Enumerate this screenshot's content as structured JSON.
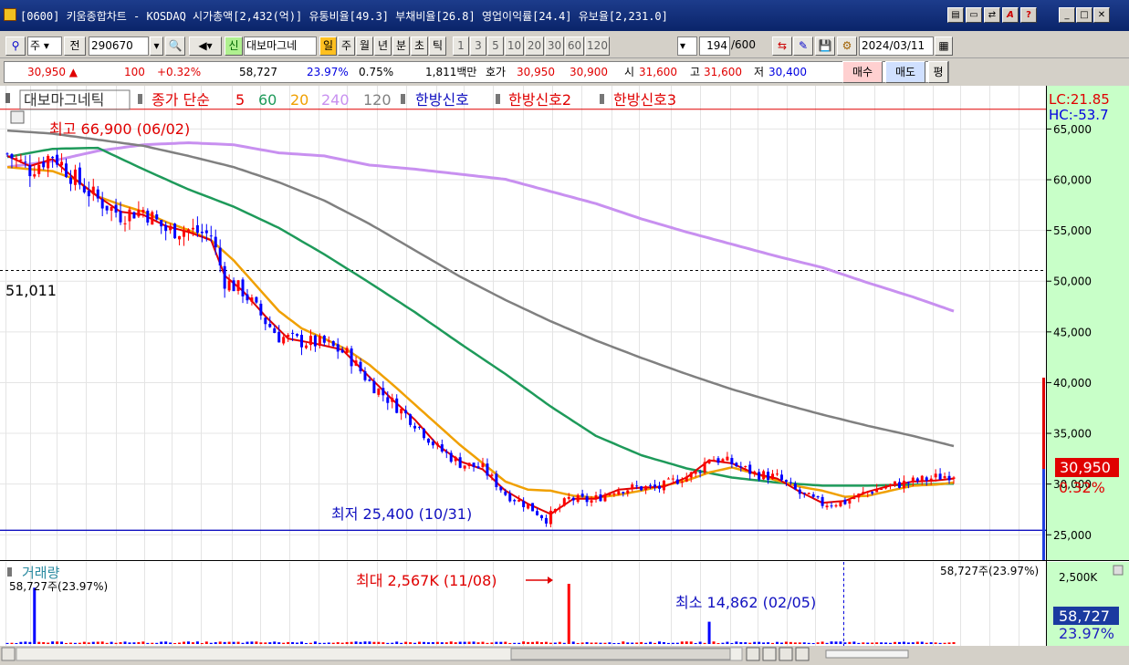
{
  "window": {
    "title": "[0600] 키움종합차트 - KOSDAQ 시가총액[2,432(억)] 유통비율[49.3] 부채비율[26.8] 영업이익률[24.4] 유보율[2,231.0]"
  },
  "toolbar": {
    "period_select": "주",
    "prev_label": "전",
    "code_value": "290670",
    "stock_name": "대보마그네",
    "period_tabs": [
      "일",
      "주",
      "월",
      "년",
      "분",
      "초",
      "틱"
    ],
    "active_period": "일",
    "interval_buttons": [
      "1",
      "3",
      "5",
      "10",
      "20",
      "30",
      "60",
      "120"
    ],
    "count_value": "194",
    "count_total": "/600",
    "date_value": "2024/03/11"
  },
  "quote": {
    "price": "30,950 ▲",
    "change": "100",
    "change_pct": "+0.32%",
    "volume": "58,727",
    "volume_ratio": "23.97%",
    "turnover": "0.75%",
    "amount": "1,811백만",
    "hoga_label": "호가",
    "ask": "30,950",
    "bid": "30,900",
    "open_label": "시",
    "open": "31,600",
    "high_label": "고",
    "high": "31,600",
    "low_label": "저",
    "low": "30,400",
    "buy_label": "매수",
    "sell_label": "매도",
    "avg_label": "평"
  },
  "colors": {
    "up": "#ff0000",
    "down": "#0000ff",
    "ma5": "#e00000",
    "ma60": "#1e9a5a",
    "ma20": "#f0a000",
    "ma240": "#c890f0",
    "ma120": "#808080",
    "axis_bg": "#c8ffc8"
  },
  "chart_data": {
    "type": "line",
    "price_panel": {
      "legend": {
        "name": "대보마그네틱",
        "close_label": "종가 단순",
        "mas": [
          "5",
          "60",
          "20",
          "240",
          "120"
        ],
        "signals": [
          "한방신호",
          "한방신호2",
          "한방신호3"
        ]
      },
      "y_ticks": [
        "65,000",
        "60,000",
        "55,000",
        "50,000",
        "45,000",
        "40,000",
        "35,000",
        "30,000",
        "25,000"
      ],
      "ylim": [
        23000,
        68500
      ],
      "max_label": "최고 66,900 (06/02)",
      "max_value": 66900,
      "min_label": "최저 25,400 (10/31)",
      "min_value": 25400,
      "ref_label": "51,011",
      "ref_value": 51011,
      "current_price_label": "30,950",
      "current_change_label": "0.32%",
      "current_price": 30950,
      "lc_label": "LC:21.85",
      "hc_label": "HC:-53.7",
      "bar_count": 194,
      "close_anchors": [
        [
          0,
          62500
        ],
        [
          5,
          61000
        ],
        [
          10,
          62500
        ],
        [
          15,
          60000
        ],
        [
          20,
          58000
        ],
        [
          25,
          56500
        ],
        [
          30,
          57000
        ],
        [
          35,
          55000
        ],
        [
          40,
          55000
        ],
        [
          45,
          54500
        ],
        [
          48,
          50000
        ],
        [
          52,
          49000
        ],
        [
          57,
          46000
        ],
        [
          60,
          44500
        ],
        [
          65,
          44000
        ],
        [
          70,
          43800
        ],
        [
          75,
          42800
        ],
        [
          80,
          40000
        ],
        [
          85,
          38000
        ],
        [
          90,
          36000
        ],
        [
          95,
          33500
        ],
        [
          100,
          32000
        ],
        [
          105,
          31500
        ],
        [
          110,
          29000
        ],
        [
          115,
          27800
        ],
        [
          119,
          26500
        ],
        [
          124,
          28500
        ],
        [
          129,
          28300
        ],
        [
          134,
          29400
        ],
        [
          139,
          29600
        ],
        [
          144,
          29600
        ],
        [
          149,
          30600
        ],
        [
          152,
          31000
        ],
        [
          155,
          32600
        ],
        [
          160,
          32000
        ],
        [
          165,
          31000
        ],
        [
          170,
          30600
        ],
        [
          175,
          29000
        ],
        [
          180,
          28000
        ],
        [
          185,
          28200
        ],
        [
          190,
          29200
        ],
        [
          195,
          29800
        ],
        [
          200,
          30200
        ],
        [
          205,
          30600
        ],
        [
          209,
          30950
        ]
      ],
      "ma5": [
        [
          0,
          62300
        ],
        [
          5,
          61300
        ],
        [
          10,
          62000
        ],
        [
          15,
          60000
        ],
        [
          20,
          58300
        ],
        [
          25,
          56800
        ],
        [
          30,
          56500
        ],
        [
          35,
          55400
        ],
        [
          40,
          54800
        ],
        [
          45,
          54000
        ],
        [
          48,
          50500
        ],
        [
          52,
          49000
        ],
        [
          57,
          46500
        ],
        [
          62,
          44300
        ],
        [
          68,
          43800
        ],
        [
          74,
          43200
        ],
        [
          80,
          40500
        ],
        [
          85,
          38300
        ],
        [
          90,
          36300
        ],
        [
          95,
          33800
        ],
        [
          100,
          32200
        ],
        [
          105,
          31400
        ],
        [
          110,
          29300
        ],
        [
          115,
          28000
        ],
        [
          120,
          27000
        ],
        [
          125,
          28500
        ],
        [
          130,
          28500
        ],
        [
          135,
          29400
        ],
        [
          140,
          29600
        ],
        [
          145,
          29700
        ],
        [
          150,
          30600
        ],
        [
          155,
          32300
        ],
        [
          160,
          32000
        ],
        [
          165,
          31000
        ],
        [
          170,
          30500
        ],
        [
          175,
          29200
        ],
        [
          180,
          28100
        ],
        [
          185,
          28300
        ],
        [
          190,
          29200
        ],
        [
          195,
          29800
        ],
        [
          200,
          30200
        ],
        [
          205,
          30300
        ],
        [
          209,
          30500
        ]
      ],
      "ma20": [
        [
          0,
          61200
        ],
        [
          5,
          61000
        ],
        [
          10,
          60800
        ],
        [
          15,
          60000
        ],
        [
          20,
          58300
        ],
        [
          25,
          57500
        ],
        [
          30,
          56800
        ],
        [
          35,
          55800
        ],
        [
          40,
          55000
        ],
        [
          45,
          54000
        ],
        [
          50,
          52000
        ],
        [
          55,
          49500
        ],
        [
          60,
          47000
        ],
        [
          65,
          45300
        ],
        [
          70,
          44300
        ],
        [
          75,
          43200
        ],
        [
          80,
          41700
        ],
        [
          85,
          39800
        ],
        [
          90,
          37800
        ],
        [
          95,
          35800
        ],
        [
          100,
          33800
        ],
        [
          105,
          32000
        ],
        [
          110,
          30200
        ],
        [
          115,
          29400
        ],
        [
          120,
          29300
        ],
        [
          125,
          28800
        ],
        [
          130,
          28600
        ],
        [
          135,
          28900
        ],
        [
          140,
          29300
        ],
        [
          145,
          29800
        ],
        [
          150,
          30300
        ],
        [
          155,
          31100
        ],
        [
          160,
          31600
        ],
        [
          165,
          31000
        ],
        [
          170,
          30300
        ],
        [
          175,
          29700
        ],
        [
          180,
          29300
        ],
        [
          185,
          28700
        ],
        [
          190,
          28800
        ],
        [
          195,
          29300
        ],
        [
          200,
          29800
        ],
        [
          205,
          29900
        ],
        [
          209,
          30100
        ]
      ],
      "ma60": [
        [
          0,
          62200
        ],
        [
          10,
          63000
        ],
        [
          20,
          63100
        ],
        [
          30,
          61000
        ],
        [
          40,
          59000
        ],
        [
          50,
          57300
        ],
        [
          60,
          55200
        ],
        [
          70,
          52600
        ],
        [
          80,
          49800
        ],
        [
          90,
          46900
        ],
        [
          100,
          43800
        ],
        [
          110,
          40800
        ],
        [
          120,
          37600
        ],
        [
          130,
          34700
        ],
        [
          140,
          32800
        ],
        [
          150,
          31500
        ],
        [
          160,
          30600
        ],
        [
          170,
          30100
        ],
        [
          180,
          29800
        ],
        [
          190,
          29800
        ],
        [
          200,
          29900
        ],
        [
          209,
          30000
        ]
      ],
      "ma120": [
        [
          0,
          64800
        ],
        [
          10,
          64500
        ],
        [
          20,
          63900
        ],
        [
          30,
          63300
        ],
        [
          40,
          62300
        ],
        [
          50,
          61200
        ],
        [
          60,
          59700
        ],
        [
          70,
          57900
        ],
        [
          80,
          55600
        ],
        [
          90,
          53000
        ],
        [
          100,
          50400
        ],
        [
          110,
          48100
        ],
        [
          120,
          46000
        ],
        [
          130,
          44100
        ],
        [
          140,
          42400
        ],
        [
          150,
          40800
        ],
        [
          160,
          39300
        ],
        [
          170,
          38000
        ],
        [
          180,
          36800
        ],
        [
          190,
          35700
        ],
        [
          200,
          34700
        ],
        [
          209,
          33700
        ]
      ],
      "ma240": [
        [
          0,
          61200
        ],
        [
          10,
          61800
        ],
        [
          20,
          62800
        ],
        [
          30,
          63400
        ],
        [
          40,
          63600
        ],
        [
          50,
          63400
        ],
        [
          60,
          62600
        ],
        [
          70,
          62300
        ],
        [
          80,
          61400
        ],
        [
          90,
          61000
        ],
        [
          100,
          60500
        ],
        [
          110,
          60000
        ],
        [
          120,
          58800
        ],
        [
          130,
          57600
        ],
        [
          140,
          56100
        ],
        [
          150,
          54800
        ],
        [
          160,
          53600
        ],
        [
          170,
          52400
        ],
        [
          180,
          51300
        ],
        [
          190,
          49800
        ],
        [
          200,
          48400
        ],
        [
          209,
          47000
        ]
      ]
    },
    "volume_panel": {
      "label": "거래량",
      "left_value_label": "58,727주(23.97%)",
      "right_value_label": "58,727주(23.97%)",
      "y_tick": "2,500K",
      "current_volume_label": "58,727",
      "current_ratio_label": "23.97%",
      "max_label": "최대 2,567K (11/08)",
      "max_value": 2567,
      "min_label": "최소 14,862 (02/05)",
      "ylim": [
        0,
        2800
      ],
      "spikes": [
        [
          6,
          2400
        ],
        [
          124,
          2567
        ],
        [
          155,
          950
        ],
        [
          210,
          300
        ]
      ]
    }
  }
}
